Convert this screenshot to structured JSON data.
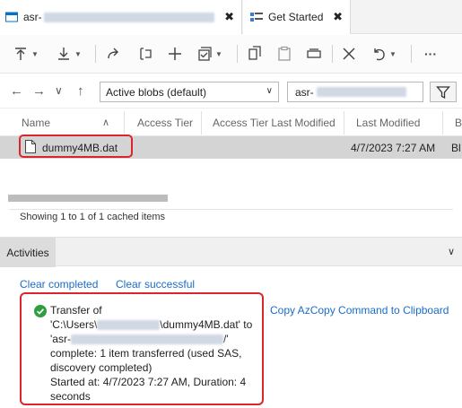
{
  "tabs": [
    {
      "title_prefix": "asr-",
      "active": false
    },
    {
      "title": "Get Started",
      "active": true
    }
  ],
  "tab_close_glyph": "✖",
  "toolbar": {
    "buttons": [
      {
        "icon": "upload-icon",
        "has_dropdown": true
      },
      {
        "icon": "download-icon",
        "has_dropdown": true
      },
      {
        "icon": "open-icon",
        "has_dropdown": false
      },
      {
        "icon": "rename-icon",
        "has_dropdown": false
      },
      {
        "icon": "new-folder-icon",
        "has_dropdown": false
      },
      {
        "icon": "select-all-icon",
        "has_dropdown": true
      },
      {
        "icon": "copy-icon",
        "has_dropdown": false
      },
      {
        "icon": "paste-icon",
        "has_dropdown": false
      },
      {
        "icon": "clone-icon",
        "has_dropdown": false
      },
      {
        "icon": "delete-icon",
        "has_dropdown": false
      },
      {
        "icon": "undo-icon",
        "has_dropdown": true
      },
      {
        "icon": "more-icon",
        "has_dropdown": false
      }
    ],
    "more_label": "···"
  },
  "nav": {
    "back": "←",
    "forward": "→",
    "recent": "∨",
    "up": "↑",
    "view_select": "Active blobs (default)",
    "path_prefix": "asr-"
  },
  "table": {
    "columns": [
      "Name",
      "Access Tier",
      "Access Tier Last Modified",
      "Last Modified",
      "B"
    ],
    "sort_glyph": "∧",
    "rows": [
      {
        "name": "dummy4MB.dat",
        "access_tier": "",
        "access_tier_last_modified": "",
        "last_modified": "4/7/2023 7:27 AM",
        "blob_type_partial": "Bl"
      }
    ],
    "status": "Showing 1 to 1 of 1 cached items"
  },
  "activities": {
    "tab_label": "Activities",
    "collapse_glyph": "∨",
    "clear_completed": "Clear completed",
    "clear_successful": "Clear successful",
    "copy_command": "Copy AzCopy Command to Clipboard",
    "item": {
      "line1": "Transfer of",
      "line2_prefix": "'C:\\Users\\",
      "line2_suffix": "\\dummy4MB.dat' to",
      "line3_prefix": "'asr-",
      "line3_suffix": "/'",
      "line4": "complete: 1 item transferred (used SAS,",
      "line5": "discovery completed)",
      "line6": "Started at: 4/7/2023 7:27 AM, Duration: 4",
      "line7": "seconds"
    }
  },
  "colors": {
    "highlight_red": "#d9262c",
    "link_blue": "#1a6dc7",
    "success_green": "#2e9e3f",
    "selected_row": "#d4d4d4"
  }
}
